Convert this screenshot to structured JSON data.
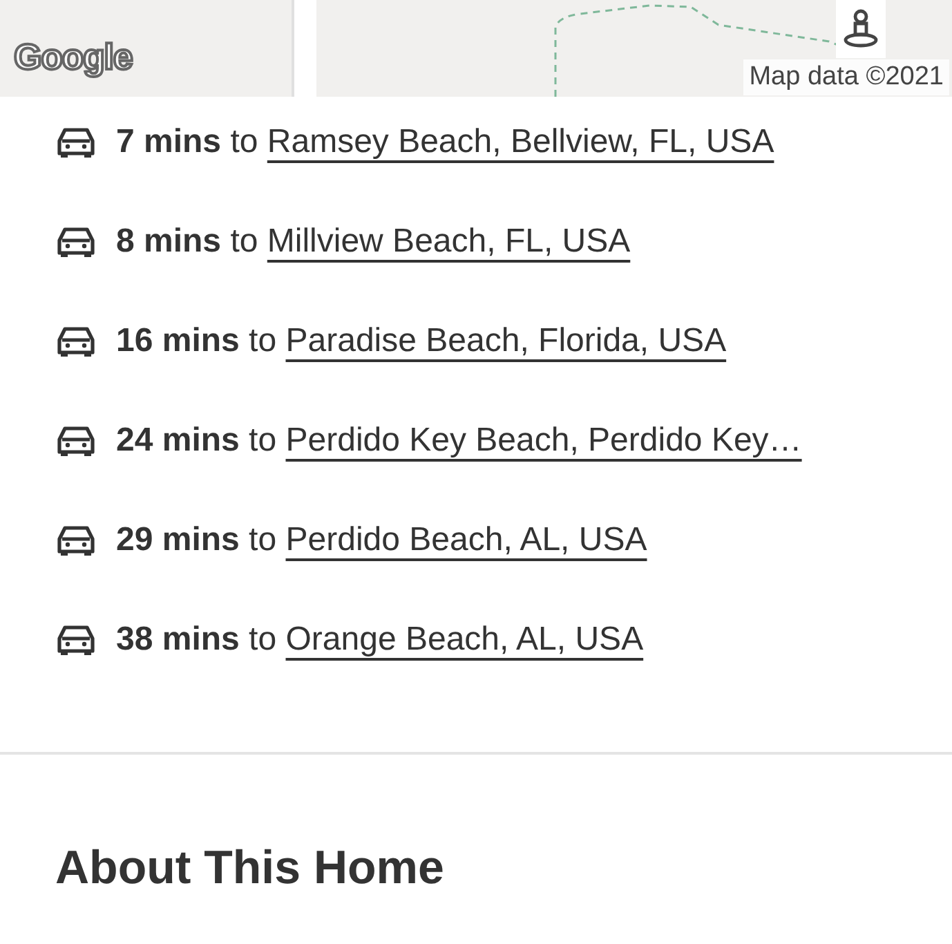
{
  "map": {
    "kind": "picture",
    "logo": "Google",
    "attribution": "Map data ©2021"
  },
  "commutes": [
    {
      "text": "**7 mins** to",
      "destination": "Ramsey Beach, Bellview, FL, USA"
    },
    {
      "text": "**8 mins** to",
      "destination": "Millview Beach, FL, USA"
    },
    {
      "text": "**16 mins** to",
      "destination": "Paradise Beach, Florida, USA"
    },
    {
      "text": "**24 mins** to",
      "destination": "Perdido Key Beach, Perdido Key…"
    },
    {
      "text": "**29 mins** to",
      "destination": "Perdido Beach, AL, USA"
    },
    {
      "text": "**38 mins** to",
      "destination": "Orange Beach, AL, USA"
    }
  ],
  "section_heading": "About This Home"
}
